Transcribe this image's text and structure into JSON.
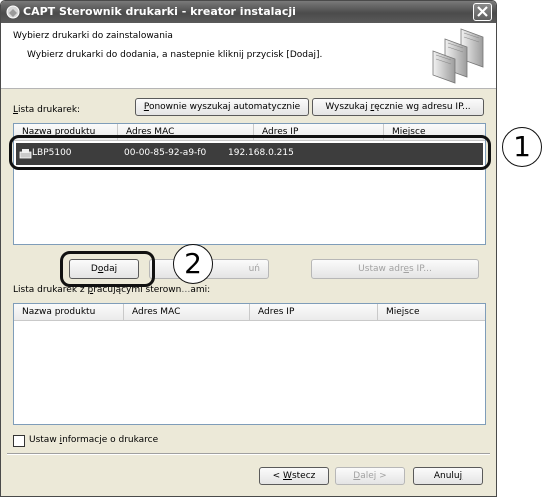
{
  "window": {
    "title": "CAPT Sterownik drukarki - kreator instalacji",
    "close_symbol": "✕"
  },
  "header": {
    "title": "Wybierz drukarki do zainstalowania",
    "subtitle": "Wybierz drukarki do dodania, a nastepnie kliknij przycisk [Dodaj]."
  },
  "printer_list": {
    "label_pre": "",
    "label_ul": "L",
    "label_post": "ista drukarek:",
    "rescan_pre": "",
    "rescan_ul": "P",
    "rescan_post": "onownie wyszukaj automatycznie",
    "search_ip_pre": "Wyszukaj ",
    "search_ip_ul": "r",
    "search_ip_post": "ęcznie wg adresu IP...",
    "columns": [
      "Nazwa produktu",
      "Adres MAC",
      "Adres IP",
      "Miejsce"
    ],
    "rows": [
      {
        "name": "LBP5100",
        "mac": "00-00-85-92-a9-f0",
        "ip": "192.168.0.215",
        "place": ""
      }
    ]
  },
  "actions": {
    "add_pre": "D",
    "add_ul": "o",
    "add_post": "daj",
    "remove_partial": "uń",
    "set_ip_pre": "Ustaw adr",
    "set_ip_ul": "e",
    "set_ip_post": "s IP..."
  },
  "existing_list": {
    "label_pre": "Lista drukarek z ",
    "label_ul": "p",
    "label_post": "racującymi sterown",
    "label_end": "ami:",
    "columns": [
      "Nazwa produktu",
      "Adres MAC",
      "Adres IP",
      "Miejsce"
    ]
  },
  "options": {
    "set_info_pre": "Ustaw ",
    "set_info_ul": "i",
    "set_info_post": "nformacje o drukarce",
    "checked": false
  },
  "nav": {
    "back_pre": "< ",
    "back_ul": "W",
    "back_post": "stecz",
    "next_pre": "",
    "next_ul": "D",
    "next_post": "alej >",
    "cancel_pre": "Anulu",
    "cancel_ul": "j",
    "cancel_post": ""
  },
  "callouts": {
    "one": "1",
    "two": "2"
  }
}
